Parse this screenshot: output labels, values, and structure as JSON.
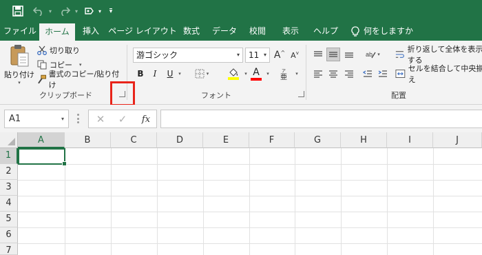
{
  "ribbon_tabs": [
    {
      "id": "file",
      "label": "ファイル"
    },
    {
      "id": "home",
      "label": "ホーム"
    },
    {
      "id": "insert",
      "label": "挿入"
    },
    {
      "id": "page-layout",
      "label": "ページ レイアウト"
    },
    {
      "id": "formulas",
      "label": "数式"
    },
    {
      "id": "data",
      "label": "データ"
    },
    {
      "id": "review",
      "label": "校閲"
    },
    {
      "id": "view",
      "label": "表示"
    },
    {
      "id": "help",
      "label": "ヘルプ"
    },
    {
      "id": "tell-me",
      "label": "何をしますか"
    }
  ],
  "clipboard": {
    "paste": "貼り付け",
    "cut": "切り取り",
    "copy": "コピー",
    "format_painter": "書式のコピー/貼り付け",
    "group_label": "クリップボード"
  },
  "font": {
    "name": "游ゴシック",
    "size": "11",
    "bold": "B",
    "italic": "I",
    "underline": "U",
    "font_color_glyph": "A",
    "increase_glyph": "A",
    "decrease_glyph": "A",
    "group_label": "フォント"
  },
  "alignment": {
    "wrap_text": "折り返して全体を表示する",
    "merge_center": "セルを結合して中央揃え",
    "group_label": "配置"
  },
  "formula_bar": {
    "name_box": "A1",
    "fx": "fx",
    "value": ""
  },
  "sheet": {
    "columns": [
      "A",
      "B",
      "C",
      "D",
      "E",
      "F",
      "G",
      "H",
      "I",
      "J"
    ],
    "rows": [
      "1",
      "2",
      "3",
      "4",
      "5",
      "6",
      "7"
    ],
    "active_cell": "A1"
  },
  "colors": {
    "accent": "#217346",
    "highlight": "#e8241a",
    "fill_yellow": "#ffff00",
    "font_red": "#ff0000"
  }
}
